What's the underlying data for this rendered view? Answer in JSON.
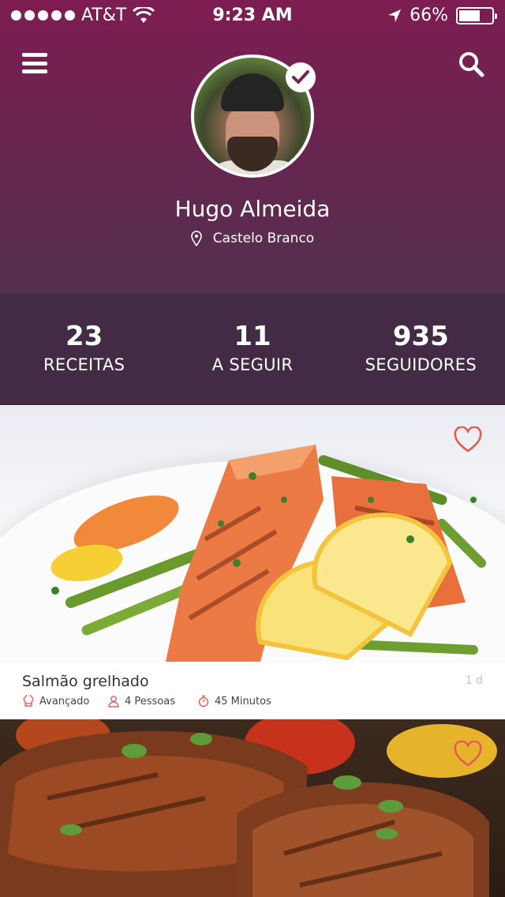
{
  "status_bar": {
    "carrier": "AT&T",
    "time": "9:23 AM",
    "battery": "66%",
    "battery_level": 0.66
  },
  "profile": {
    "name": "Hugo Almeida",
    "location": "Castelo Branco"
  },
  "stats": [
    {
      "value": "23",
      "label": "RECEITAS"
    },
    {
      "value": "11",
      "label": "A SEGUIR"
    },
    {
      "value": "935",
      "label": "SEGUIDORES"
    }
  ],
  "recipes": [
    {
      "title": "Salmão grelhado",
      "age": "1 d",
      "difficulty": "Avançado",
      "servings": "4 Pessoas",
      "duration": "45 Minutos"
    }
  ],
  "colors": {
    "header_top": "#7e1d52",
    "header_bottom": "#54304f",
    "stats_bg": "#442b45",
    "accent": "#e35d55"
  },
  "icons": [
    "menu-icon",
    "search-icon",
    "verified-check-icon",
    "location-pin-icon",
    "heart-icon",
    "chef-hat-icon",
    "person-icon",
    "stopwatch-icon"
  ]
}
